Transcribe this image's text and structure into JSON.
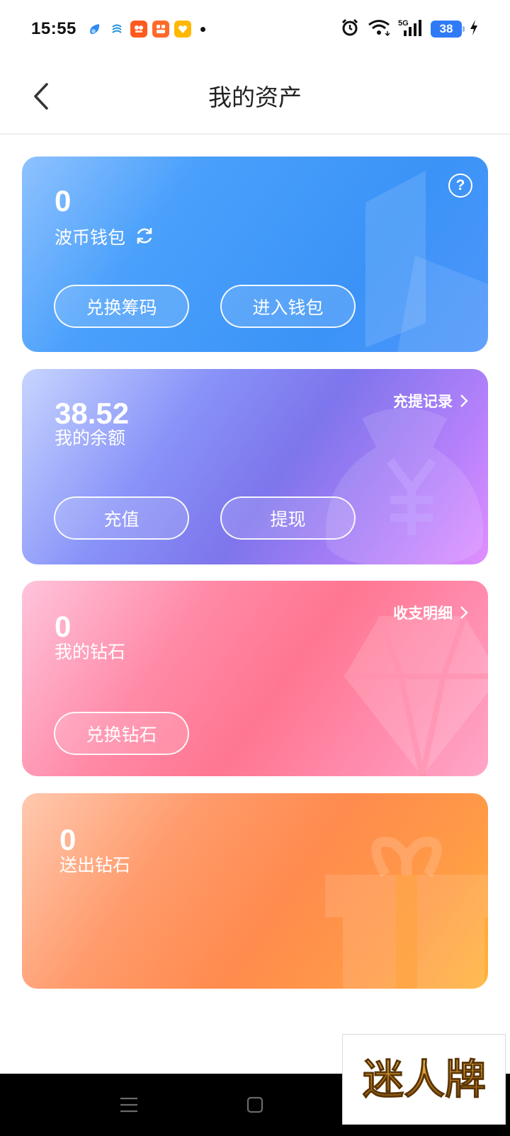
{
  "status_bar": {
    "time": "15:55",
    "notification_icons": [
      "browser-icon",
      "china-mobile-icon",
      "app-icon",
      "app-icon",
      "app-icon"
    ],
    "battery_level": "38",
    "network": "5G"
  },
  "header": {
    "title": "我的资产"
  },
  "wallet_card": {
    "amount": "0",
    "label": "波币钱包",
    "help_symbol": "?",
    "buttons": [
      "兑换筹码",
      "进入钱包"
    ]
  },
  "balance_card": {
    "amount": "38.52",
    "label": "我的余额",
    "link": "充提记录",
    "buttons": [
      "充值",
      "提现"
    ]
  },
  "diamond_card": {
    "amount": "0",
    "label": "我的钻石",
    "link": "收支明细",
    "buttons": [
      "兑换钻石"
    ]
  },
  "sent_card": {
    "amount": "0",
    "label": "送出钻石"
  },
  "watermark": {
    "text": "迷人牌"
  },
  "colors": {
    "wallet": "#3b93f7",
    "balance": "#7e75ec",
    "diamond": "#ff7691",
    "sent": "#ff8b4e",
    "battery": "#2f7bf6"
  }
}
